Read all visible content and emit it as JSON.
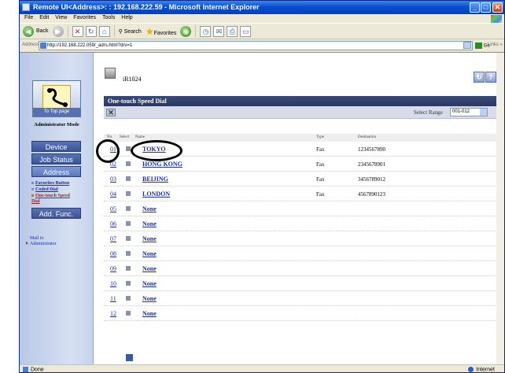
{
  "window": {
    "title": "Remote UI<Address>: : 192.168.222.59 - Microsoft Internet Explorer"
  },
  "menu": [
    "File",
    "Edit",
    "View",
    "Favorites",
    "Tools",
    "Help"
  ],
  "toolbar": {
    "back_label": "Back",
    "search_label": "Search",
    "favorites_label": "Favorites"
  },
  "address_bar": {
    "label": "Address",
    "url": "http://192.168.222.059/_adrs.html?drv=1",
    "go_label": "Go",
    "links_label": "Links"
  },
  "sidebar": {
    "top_link": "To Top page",
    "mode": "Administrator Mode",
    "nav": [
      "Device",
      "Job Status",
      "Address",
      "Add. Func."
    ],
    "submenu": [
      "Favorites Button",
      "Coded Dial",
      "One-touch Speed Dial"
    ],
    "mail_to": "Mail to Administrator"
  },
  "header": {
    "device_name": "iR1024",
    "section_title": "One-touch Speed Dial",
    "select_range_label": "Select Range",
    "select_range_value": "001-012"
  },
  "table": {
    "columns": [
      "No.",
      "Select",
      "Name",
      "Type",
      "Destination"
    ],
    "rows": [
      {
        "no": "01",
        "name": "TOKYO",
        "type": "Fax",
        "dest": "1234567890"
      },
      {
        "no": "02",
        "name": "HONG KONG",
        "type": "Fax",
        "dest": "2345678901"
      },
      {
        "no": "03",
        "name": "BEIJING",
        "type": "Fax",
        "dest": "3456789012"
      },
      {
        "no": "04",
        "name": "LONDON",
        "type": "Fax",
        "dest": "4567890123"
      },
      {
        "no": "05",
        "name": "None",
        "type": "",
        "dest": ""
      },
      {
        "no": "06",
        "name": "None",
        "type": "",
        "dest": ""
      },
      {
        "no": "07",
        "name": "None",
        "type": "",
        "dest": ""
      },
      {
        "no": "08",
        "name": "None",
        "type": "",
        "dest": ""
      },
      {
        "no": "09",
        "name": "None",
        "type": "",
        "dest": ""
      },
      {
        "no": "10",
        "name": "None",
        "type": "",
        "dest": ""
      },
      {
        "no": "11",
        "name": "None",
        "type": "",
        "dest": ""
      },
      {
        "no": "12",
        "name": "None",
        "type": "",
        "dest": ""
      }
    ]
  },
  "status": {
    "left": "Done",
    "zone": "Internet"
  }
}
